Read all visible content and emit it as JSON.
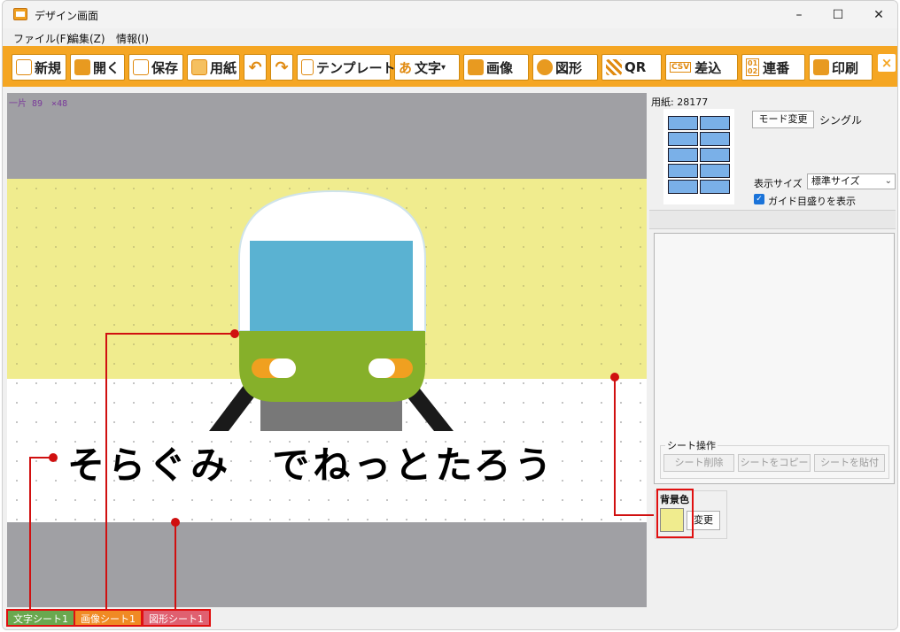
{
  "window": {
    "title": "デザイン画面",
    "minimize": "–",
    "maximize": "☐",
    "close": "✕"
  },
  "menu": [
    "ファイル(F)",
    "編集(Z)",
    "情報(I)"
  ],
  "toolbar": {
    "new": "新規",
    "open": "開く",
    "save": "保存",
    "paper": "用紙",
    "template": "テンプレート",
    "text": "文字",
    "text_caret": "▾",
    "image": "画像",
    "shape": "図形",
    "qr": "QR",
    "merge": "差込",
    "serial": "連番",
    "print": "印刷",
    "close": "×",
    "icon_text": "あ",
    "icon_csv": "CSV",
    "icon_serial_top": "01",
    "icon_serial_bottom": "02"
  },
  "canvas": {
    "size_readout": "一片 89　×48",
    "caption": "そらぐみ　でねっとたろう",
    "background_color": "#f0ec8e"
  },
  "sheet_tabs": [
    {
      "label": "文字シート1",
      "color": "#6aa84f"
    },
    {
      "label": "画像シート1",
      "color": "#f08a24"
    },
    {
      "label": "図形シート1",
      "color": "#e06070"
    }
  ],
  "panel": {
    "paper_label": "用紙: 28177",
    "mode_button": "モード変更",
    "mode_value": "シングル",
    "display_size_label": "表示サイズ",
    "display_size_value": "標準サイズ",
    "guide_checkbox_label": "ガイド目盛りを表示",
    "guide_checked": true,
    "sheet_ops_title": "シート操作",
    "sheet_delete": "シート削除",
    "sheet_copy": "シートをコピー",
    "sheet_paste": "シートを貼付",
    "bg_title": "背景色",
    "bg_button": "変更"
  }
}
